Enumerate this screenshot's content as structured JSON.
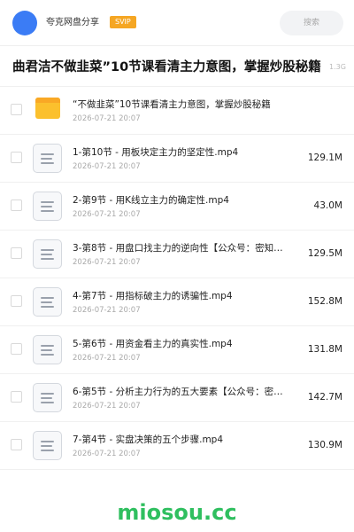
{
  "header": {
    "site_name": "夸克网盘分享",
    "badge": "SVIP",
    "search_placeholder": "搜索"
  },
  "share": {
    "title": "曲君洁不做韭菜”10节课看清主力意图，掌握炒股秘籍",
    "total_size": "1.3G"
  },
  "files": [
    {
      "type": "folder",
      "name": "“不做韭菜”10节课看清主力意图，掌握炒股秘籍",
      "date": "2026-07-21 20:07",
      "size": ""
    },
    {
      "type": "file",
      "name": "1-第10节 - 用板块定主力的坚定性.mp4",
      "date": "2026-07-21 20:07",
      "size": "129.1M"
    },
    {
      "type": "file",
      "name": "2-第9节 - 用K线立主力的确定性.mp4",
      "date": "2026-07-21 20:07",
      "size": "43.0M"
    },
    {
      "type": "file",
      "name": "3-第8节 - 用盘口找主力的逆向性【公众号：密知…",
      "date": "2026-07-21 20:07",
      "size": "129.5M"
    },
    {
      "type": "file",
      "name": "4-第7节 - 用指标破主力的诱骗性.mp4",
      "date": "2026-07-21 20:07",
      "size": "152.8M"
    },
    {
      "type": "file",
      "name": "5-第6节 - 用资金看主力的真实性.mp4",
      "date": "2026-07-21 20:07",
      "size": "131.8M"
    },
    {
      "type": "file",
      "name": "6-第5节 - 分析主力行为的五大要素【公众号：密…",
      "date": "2026-07-21 20:07",
      "size": "142.7M"
    },
    {
      "type": "file",
      "name": "7-第4节 - 实盘决策的五个步骤.mp4",
      "date": "2026-07-21 20:07",
      "size": "130.9M"
    }
  ],
  "footer": {
    "logo": "miosou.cc"
  },
  "colors": {
    "avatar": "#3b7cf5",
    "badge": "#f5a623",
    "folder": "#fbc02d",
    "logo": "#2fbf5f"
  },
  "icons": {
    "folder": "folder-icon",
    "file": "video-file-icon"
  }
}
